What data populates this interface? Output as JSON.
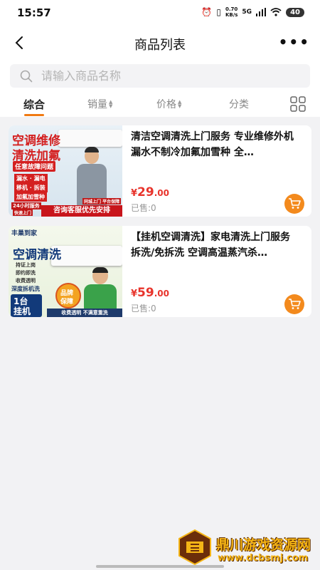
{
  "status_bar": {
    "time": "15:57",
    "net_speed_value": "0.70",
    "net_speed_unit": "KB/s",
    "signal": "5G",
    "battery": "40"
  },
  "header": {
    "title": "商品列表"
  },
  "search": {
    "placeholder": "请输入商品名称"
  },
  "tabs": [
    {
      "label": "综合",
      "active": true
    },
    {
      "label": "销量"
    },
    {
      "label": "价格"
    },
    {
      "label": "分类"
    }
  ],
  "products": [
    {
      "title": "清洁空调清洗上门服务 专业维修外机 漏水不制冷加氟加雪种 全…",
      "price_symbol": "¥",
      "price_int": "29",
      "price_dec": ".00",
      "sold": "已售:0",
      "image": {
        "headline_1": "空调维修",
        "headline_2": "清洗加氟",
        "tag": "任意故障问题",
        "items": [
          "漏水 · 漏电",
          "移机 · 拆装",
          "加氟加雪种"
        ],
        "badge": "24小时服务",
        "badge_sub": "快速上门",
        "footer": "咨询客服优先安排",
        "chips": "同城上门  平台保障"
      }
    },
    {
      "title": "【挂机空调清洗】家电清洗上门服务 拆洗/免拆洗 空调高温蒸汽杀…",
      "price_symbol": "¥",
      "price_int": "59",
      "price_dec": ".00",
      "sold": "已售:0",
      "image": {
        "brand": "丰巢到家",
        "headline": "空调清洗",
        "checks": [
          "持证上岗",
          "即约即洗",
          "收费透明"
        ],
        "deep": "深度拆机洗",
        "unit_1": "1台",
        "unit_2": "挂机",
        "seal_1": "品牌",
        "seal_2": "保障",
        "footer": "收费透明  不满意重洗"
      }
    }
  ],
  "watermark": {
    "name": "鼎川游戏资源网",
    "url": "www.dcbsmj.com"
  },
  "colors": {
    "accent": "#f07a13",
    "price": "#e8342c",
    "cart": "#f38a1d"
  }
}
